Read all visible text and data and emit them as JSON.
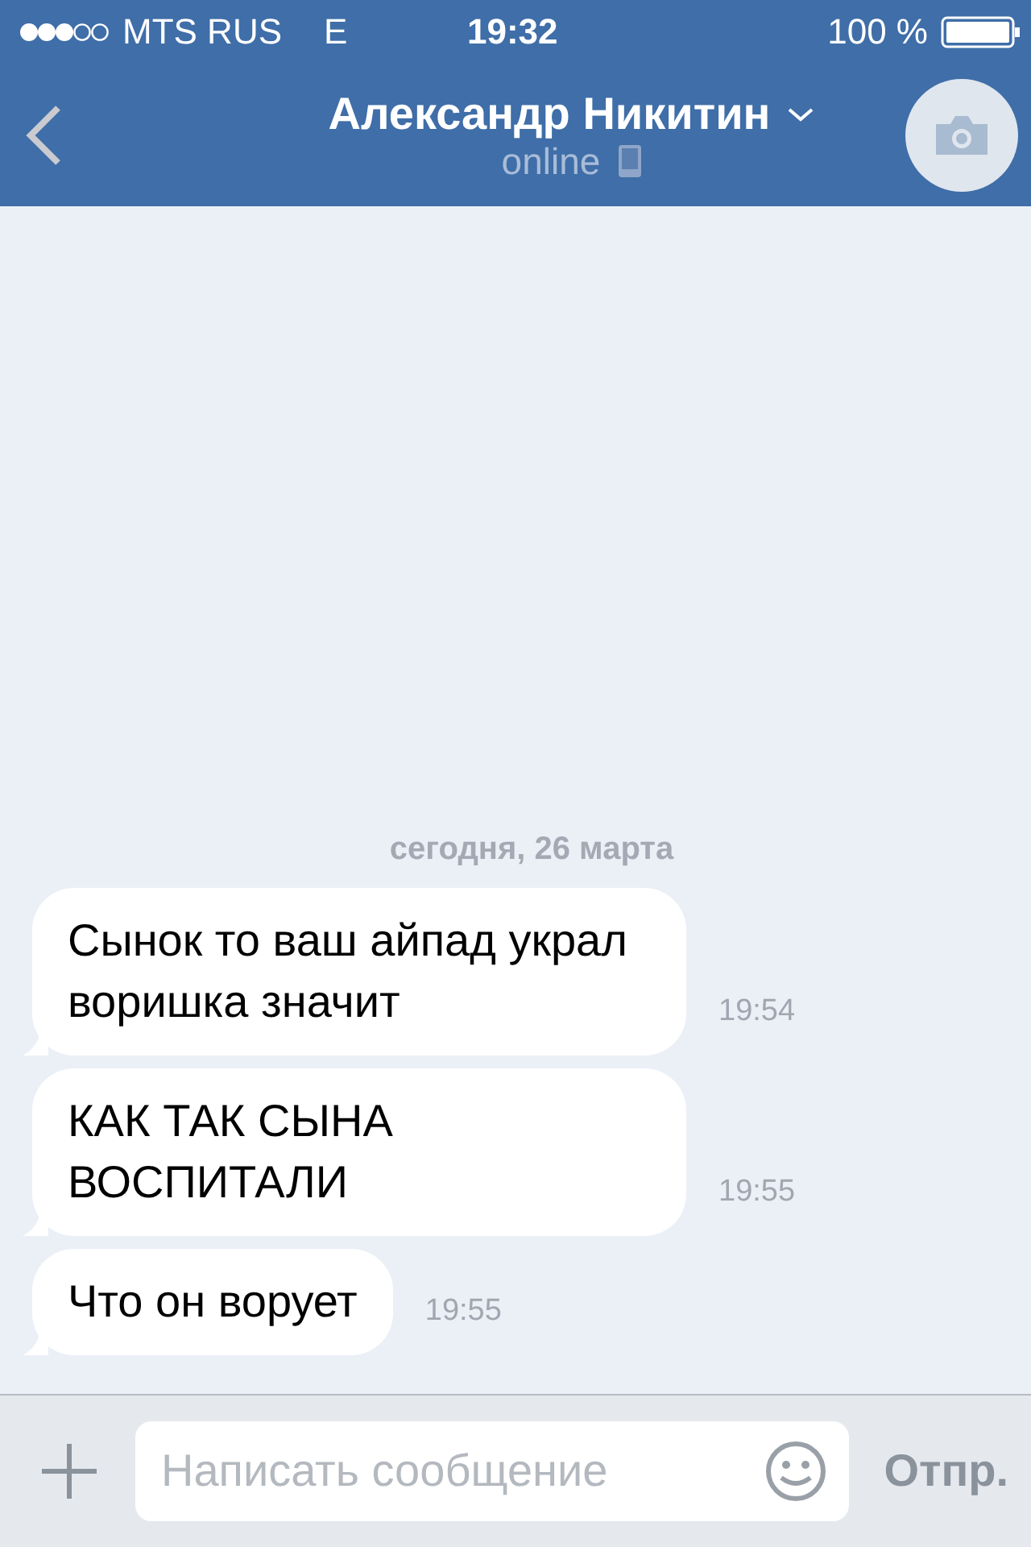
{
  "status_bar": {
    "carrier": "MTS RUS",
    "network": "E",
    "time": "19:32",
    "battery": "100 %"
  },
  "header": {
    "title": "Александр Никитин",
    "status": "online"
  },
  "date_label": "сегодня, 26 марта",
  "messages": [
    {
      "text": "Сынок то ваш айпад украл воришка значит",
      "time": "19:54"
    },
    {
      "text": "КАК ТАК СЫНА ВОСПИТАЛИ",
      "time": "19:55"
    },
    {
      "text": "Что он ворует",
      "time": "19:55"
    }
  ],
  "composer": {
    "placeholder": "Написать сообщение",
    "send": "Отпр."
  }
}
